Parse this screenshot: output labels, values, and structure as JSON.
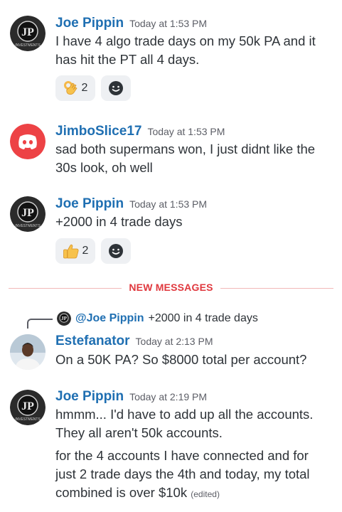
{
  "messages": [
    {
      "author": "Joe Pippin",
      "timestamp": "Today at 1:53 PM",
      "lines": [
        "I have 4 algo trade days on my 50k PA and it",
        "has hit the PT all 4 days."
      ],
      "reaction": {
        "emoji": "ok-hand",
        "count": "2"
      }
    },
    {
      "author": "JimboSlice17",
      "timestamp": "Today at 1:53 PM",
      "lines": [
        "sad both supermans won, I just didnt like the",
        "30s look, oh well"
      ]
    },
    {
      "author": "Joe Pippin",
      "timestamp": "Today at 1:53 PM",
      "lines": [
        "+2000 in 4 trade days"
      ],
      "reaction": {
        "emoji": "thumbs-up",
        "count": "2"
      }
    },
    {
      "author": "Estefanator",
      "timestamp": "Today at 2:13 PM",
      "reply": {
        "mention": "@Joe Pippin",
        "text": "+2000 in 4 trade days"
      },
      "lines": [
        "On a 50K PA? So $8000 total per account?"
      ]
    },
    {
      "author": "Joe Pippin",
      "timestamp": "Today at 2:19 PM",
      "lines": [
        "hmmm... I'd have to add up all the accounts.",
        "They all aren't 50k accounts."
      ],
      "lines2": [
        "for the 4 accounts I have connected and for",
        "just 2 trade days the 4th and today, my total",
        "combined is over $10k"
      ],
      "edited": "(edited)"
    }
  ],
  "divider": {
    "label": "NEW MESSAGES"
  },
  "avatar_logo_text": {
    "initials": "JP",
    "ring": "INVESTMENTS"
  },
  "colors": {
    "name": "#1f6fb2",
    "divider": "#e0383e",
    "discord": "#ed4245",
    "reaction_bg": "#eef0f3"
  }
}
